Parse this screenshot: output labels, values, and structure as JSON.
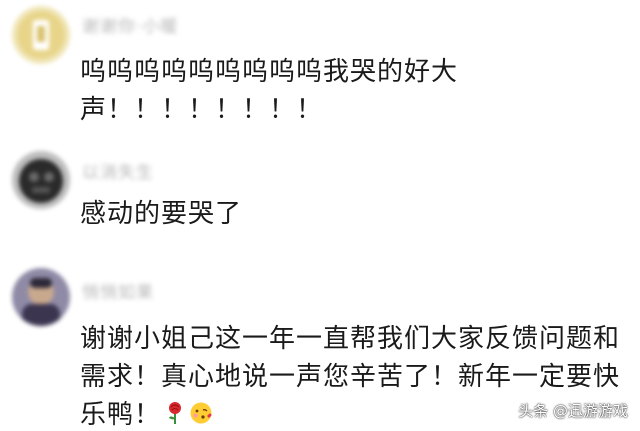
{
  "comments": [
    {
      "username": "谢谢你·小暖",
      "text": "呜呜呜呜呜呜呜呜呜我哭的好大声！！！！！！！！"
    },
    {
      "username": "以消失生",
      "text": "感动的要哭了"
    },
    {
      "username": "悄悄如果",
      "text": "谢谢小姐己这一年一直帮我们大家反馈问题和需求！真心地说一声您辛苦了！新年一定要快乐鸭！"
    }
  ],
  "watermark": "头条 @迅游游戏",
  "emoji": [
    "rose-icon",
    "face-blowing-kiss-icon"
  ],
  "colors": {
    "text": "#1a1a1a",
    "username": "#b8b8b8",
    "avatar1": "#e8d58a",
    "avatar2": "#2a2a2a",
    "avatar3": "#3b3550"
  }
}
